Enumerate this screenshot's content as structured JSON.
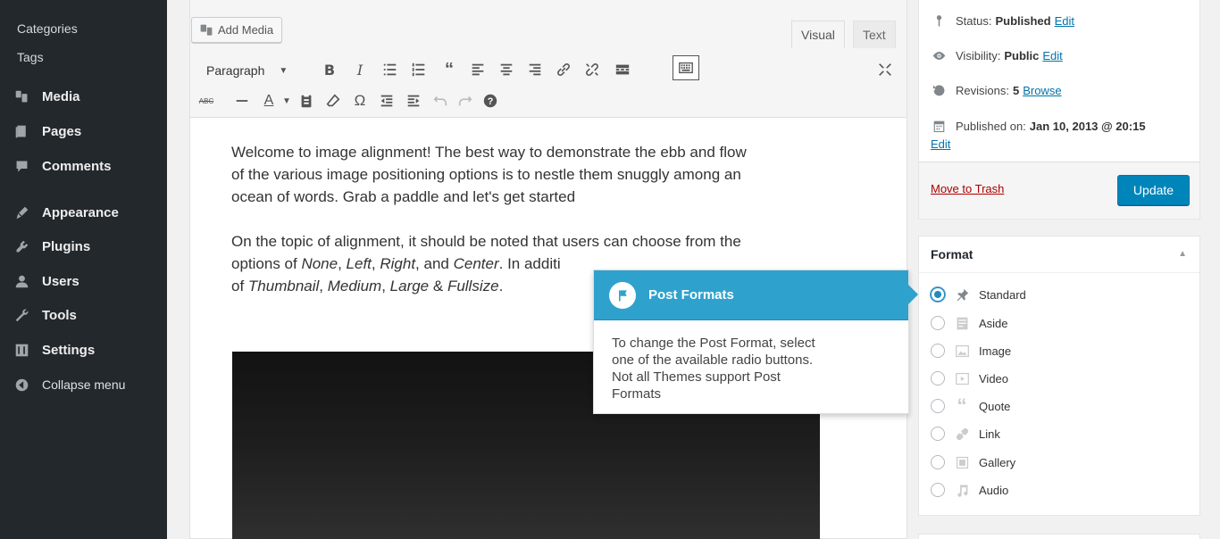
{
  "sidebar": {
    "sub_items": [
      "Categories",
      "Tags"
    ],
    "items": [
      {
        "label": "Media",
        "icon": "media-icon"
      },
      {
        "label": "Pages",
        "icon": "pages-icon"
      },
      {
        "label": "Comments",
        "icon": "comments-icon"
      },
      {
        "label": "Appearance",
        "icon": "appearance-icon"
      },
      {
        "label": "Plugins",
        "icon": "plugins-icon"
      },
      {
        "label": "Users",
        "icon": "users-icon"
      },
      {
        "label": "Tools",
        "icon": "tools-icon"
      },
      {
        "label": "Settings",
        "icon": "settings-icon"
      }
    ],
    "collapse_label": "Collapse menu"
  },
  "editor": {
    "add_media_label": "Add Media",
    "tabs": {
      "visual": "Visual",
      "text": "Text"
    },
    "format_select": "Paragraph",
    "content": {
      "p1": [
        "Welcome to image alignment! The best way to demonstrate the ebb and flow",
        "of the various image positioning options is to nestle them snuggly among an",
        "ocean of words. Grab a paddle and let's get started"
      ],
      "p2_line1": "On the topic of alignment, it should be noted that users can choose from the",
      "p2_line2_a": "options of ",
      "p2_line2_none": "None",
      "p2_line2_sep1": ", ",
      "p2_line2_left": "Left",
      "p2_line2_sep2": ", ",
      "p2_line2_right": "Right",
      "p2_line2_and": ", and ",
      "p2_line2_center": "Center",
      "p2_line2_b": ". In additi",
      "p2_line3_of": "of ",
      "p2_line3_thumb": "Thumbnail",
      "p2_line3_sep1": ", ",
      "p2_line3_medium": "Medium",
      "p2_line3_sep2": ", ",
      "p2_line3_large": "Large",
      "p2_line3_amp": " & ",
      "p2_line3_full": "Fullsize",
      "p2_line3_end": "."
    }
  },
  "pointer": {
    "title": "Post Formats",
    "body": [
      "To change the Post Format, select",
      "one of the available radio buttons.",
      "Not all Themes support Post",
      "Formats"
    ]
  },
  "publish": {
    "status_label": "Status:",
    "status_value": "Published",
    "visibility_label": "Visibility:",
    "visibility_value": "Public",
    "revisions_label": "Revisions:",
    "revisions_value": "5",
    "browse_label": "Browse",
    "published_on_label": "Published on:",
    "published_on_value": "Jan 10, 2013 @ 20:15",
    "edit_label": "Edit",
    "trash_label": "Move to Trash",
    "update_label": "Update"
  },
  "format_box": {
    "title": "Format",
    "selected": "Standard",
    "options": [
      {
        "label": "Standard",
        "icon": "pin-icon"
      },
      {
        "label": "Aside",
        "icon": "aside-icon"
      },
      {
        "label": "Image",
        "icon": "image-icon"
      },
      {
        "label": "Video",
        "icon": "video-icon"
      },
      {
        "label": "Quote",
        "icon": "quote-icon"
      },
      {
        "label": "Link",
        "icon": "link-icon"
      },
      {
        "label": "Gallery",
        "icon": "gallery-icon"
      },
      {
        "label": "Audio",
        "icon": "audio-icon"
      }
    ]
  },
  "colors": {
    "sidebar_bg": "#23282d",
    "accent": "#2ea2cc",
    "update_button": "#0085ba",
    "trash_link": "#a00"
  }
}
